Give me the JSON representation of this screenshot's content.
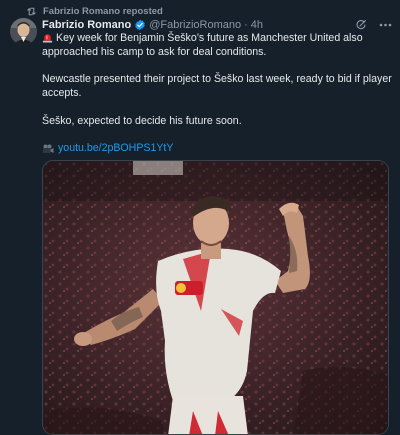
{
  "repost": {
    "label": "Fabrizio Romano reposted"
  },
  "author": {
    "name": "Fabrizio Romano",
    "handle": "@FabrizioRomano",
    "separator": "·",
    "time": "4h"
  },
  "tweet": {
    "paragraph1": "Key week for Benjamin Šeško’s future as Manchester United also approached his camp to ask for deal conditions.",
    "paragraph2": "Newcastle presented their project to Šeško last week, ready to bid if player accepts.",
    "paragraph3": "Šeško, expected to decide his future soon.",
    "link": "youtu.be/2pBOHPS1YtY"
  },
  "icons": {
    "repost": "repost-icon",
    "verified": "verified-badge-icon",
    "grok": "grok-icon",
    "more": "more-options-icon",
    "siren": "siren-emoji-icon",
    "camera": "movie-camera-emoji-icon"
  },
  "colors": {
    "background": "#15202b",
    "text": "#e7e9ea",
    "muted": "#8b98a5",
    "link": "#1d9bf0",
    "verified": "#1d9bf0"
  }
}
